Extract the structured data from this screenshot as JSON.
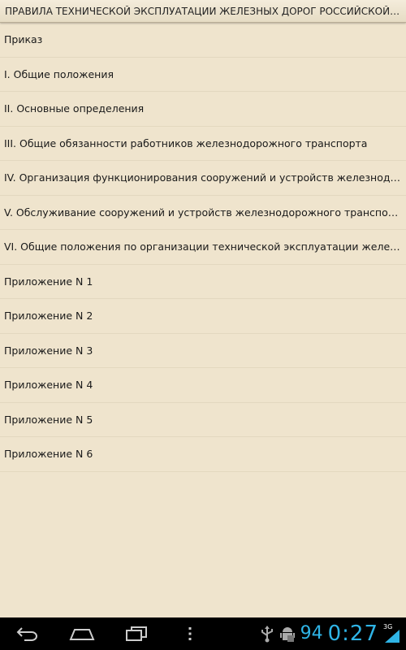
{
  "header": {
    "title": "ПРАВИЛА ТЕХНИЧЕСКОЙ ЭКСПЛУАТАЦИИ ЖЕЛЕЗНЫХ ДОРОГ РОССИЙСКОЙ ФЕДЕРАЦИИ"
  },
  "list": {
    "items": [
      {
        "label": "Приказ"
      },
      {
        "label": "I. Общие положения"
      },
      {
        "label": "II. Основные определения"
      },
      {
        "label": "III. Общие обязанности работников железнодорожного транспорта"
      },
      {
        "label": "IV. Организация функционирования сооружений и устройств железнодорожного транспорта"
      },
      {
        "label": "V. Обслуживание сооружений и устройств железнодорожного транспорта"
      },
      {
        "label": "VI. Общие положения по организации технической эксплуатации железнодорожного транспорта"
      },
      {
        "label": "Приложение N 1"
      },
      {
        "label": "Приложение N 2"
      },
      {
        "label": "Приложение N 3"
      },
      {
        "label": "Приложение N 4"
      },
      {
        "label": "Приложение N 5"
      },
      {
        "label": "Приложение N 6"
      }
    ]
  },
  "system_bar": {
    "battery_percent": "94",
    "time": "0:27",
    "network_type": "3G",
    "icons": [
      "back-icon",
      "home-icon",
      "recent-apps-icon",
      "menu-icon",
      "usb-icon",
      "android-debug-icon",
      "signal-icon"
    ],
    "accent_color": "#2fb4e6"
  },
  "colors": {
    "background": "#efe4cd",
    "divider": "#e3d8bf",
    "text": "#1a1a1a",
    "nav_background": "#000000"
  }
}
